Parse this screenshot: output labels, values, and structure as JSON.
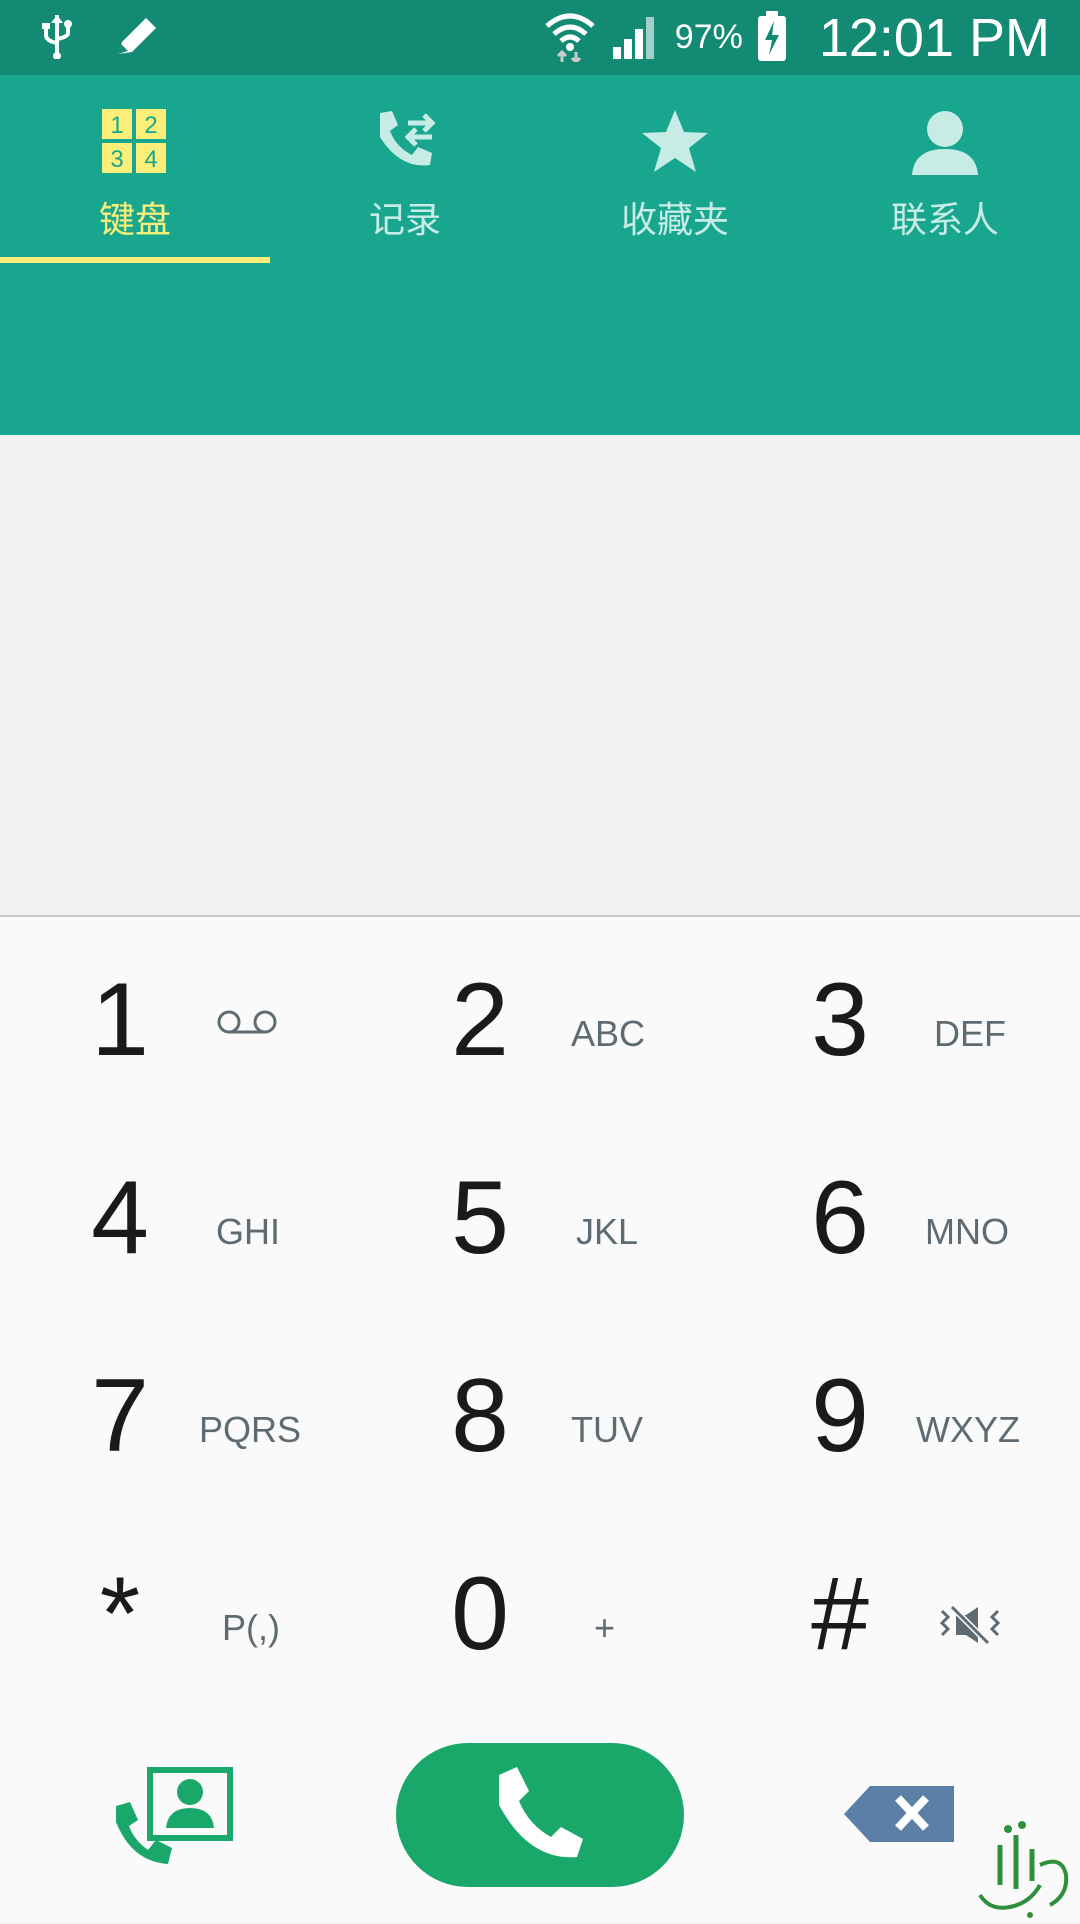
{
  "status_bar": {
    "icons": [
      "usb-icon",
      "pencil-icon",
      "wifi-icon",
      "signal-icon",
      "battery-charging-icon"
    ],
    "battery_percent": "97%",
    "time": "12:01 PM"
  },
  "tabs": [
    {
      "label": "键盘",
      "icon": "keypad-icon",
      "active": true
    },
    {
      "label": "记录",
      "icon": "call-log-icon",
      "active": false
    },
    {
      "label": "收藏夹",
      "icon": "star-icon",
      "active": false
    },
    {
      "label": "联系人",
      "icon": "person-icon",
      "active": false
    }
  ],
  "keypad_icon_digits": [
    "1",
    "2",
    "3",
    "4"
  ],
  "keys": [
    {
      "digit": "1",
      "letters": "",
      "sub_icon": "voicemail-icon"
    },
    {
      "digit": "2",
      "letters": "ABC"
    },
    {
      "digit": "3",
      "letters": "DEF"
    },
    {
      "digit": "4",
      "letters": "GHI"
    },
    {
      "digit": "5",
      "letters": "JKL"
    },
    {
      "digit": "6",
      "letters": "MNO"
    },
    {
      "digit": "7",
      "letters": "PQRS"
    },
    {
      "digit": "8",
      "letters": "TUV"
    },
    {
      "digit": "9",
      "letters": "WXYZ"
    },
    {
      "digit": "*",
      "letters": "P(,)"
    },
    {
      "digit": "0",
      "letters": "+"
    },
    {
      "digit": "#",
      "letters": "",
      "sub_icon": "vibrate-off-icon"
    }
  ],
  "actions": {
    "contacts_icon": "add-contact-icon",
    "call_icon": "phone-icon",
    "backspace_icon": "backspace-icon"
  },
  "colors": {
    "status_bar": "#138a73",
    "header": "#18a68e",
    "active_tab": "#fbef7a",
    "inactive_tab": "#c7ece5",
    "call_button": "#1aa86a",
    "backspace": "#5b7fa6"
  }
}
